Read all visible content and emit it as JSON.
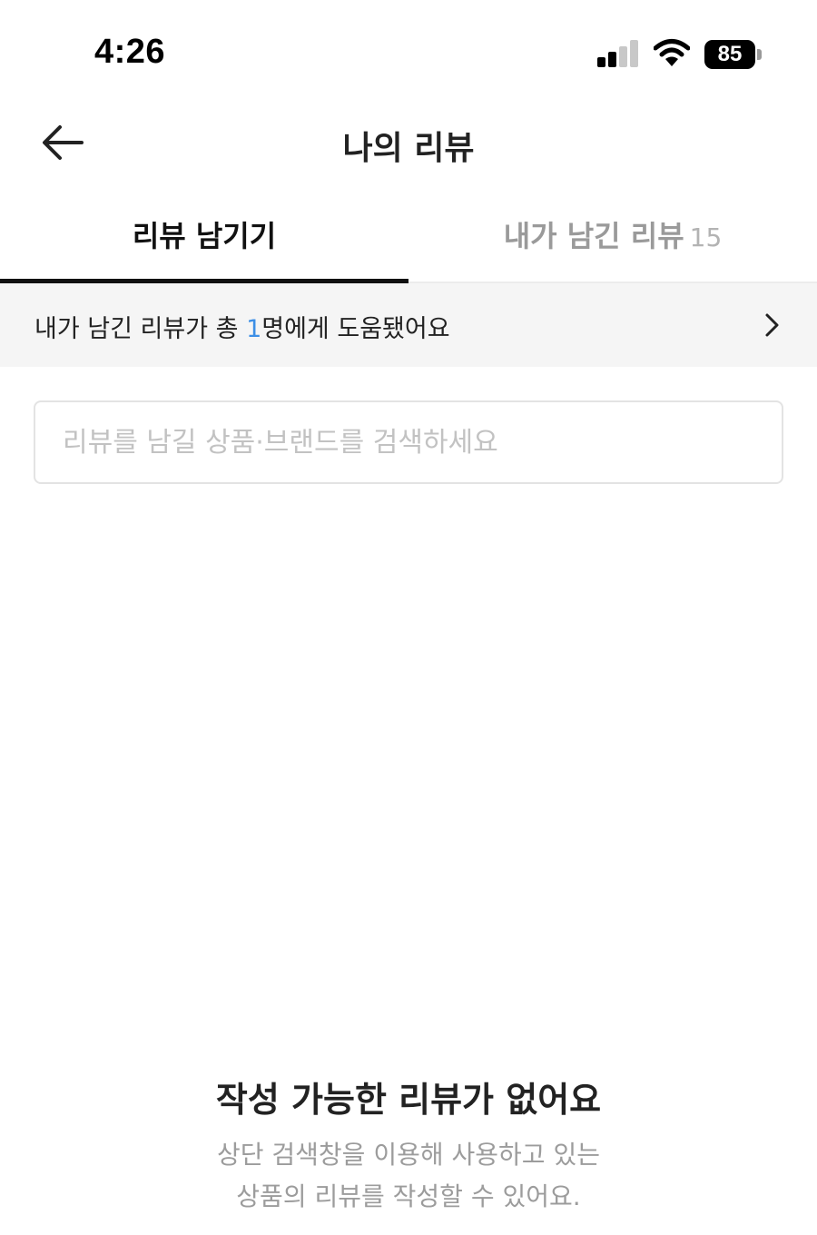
{
  "status_bar": {
    "time": "4:26",
    "battery_level": "85",
    "signal_bars_filled": 2,
    "signal_bars_total": 4
  },
  "header": {
    "title": "나의 리뷰",
    "back_icon": "arrow-left-icon"
  },
  "tabs": [
    {
      "label": "리뷰 남기기",
      "count": "",
      "active": true
    },
    {
      "label": "내가 남긴 리뷰",
      "count": "15",
      "active": false
    }
  ],
  "helped_banner": {
    "prefix": "내가 남긴 리뷰가 총 ",
    "count": "1",
    "suffix": "명에게 도움됐어요",
    "icon": "chevron-right-icon",
    "count_color": "#3d8fe6"
  },
  "search": {
    "placeholder": "리뷰를 남길 상품·브랜드를 검색하세요",
    "value": ""
  },
  "empty_state": {
    "title": "작성 가능한 리뷰가 없어요",
    "line1": "상단 검색창을 이용해 사용하고 있는",
    "line2": "상품의 리뷰를 작성할 수 있어요."
  }
}
